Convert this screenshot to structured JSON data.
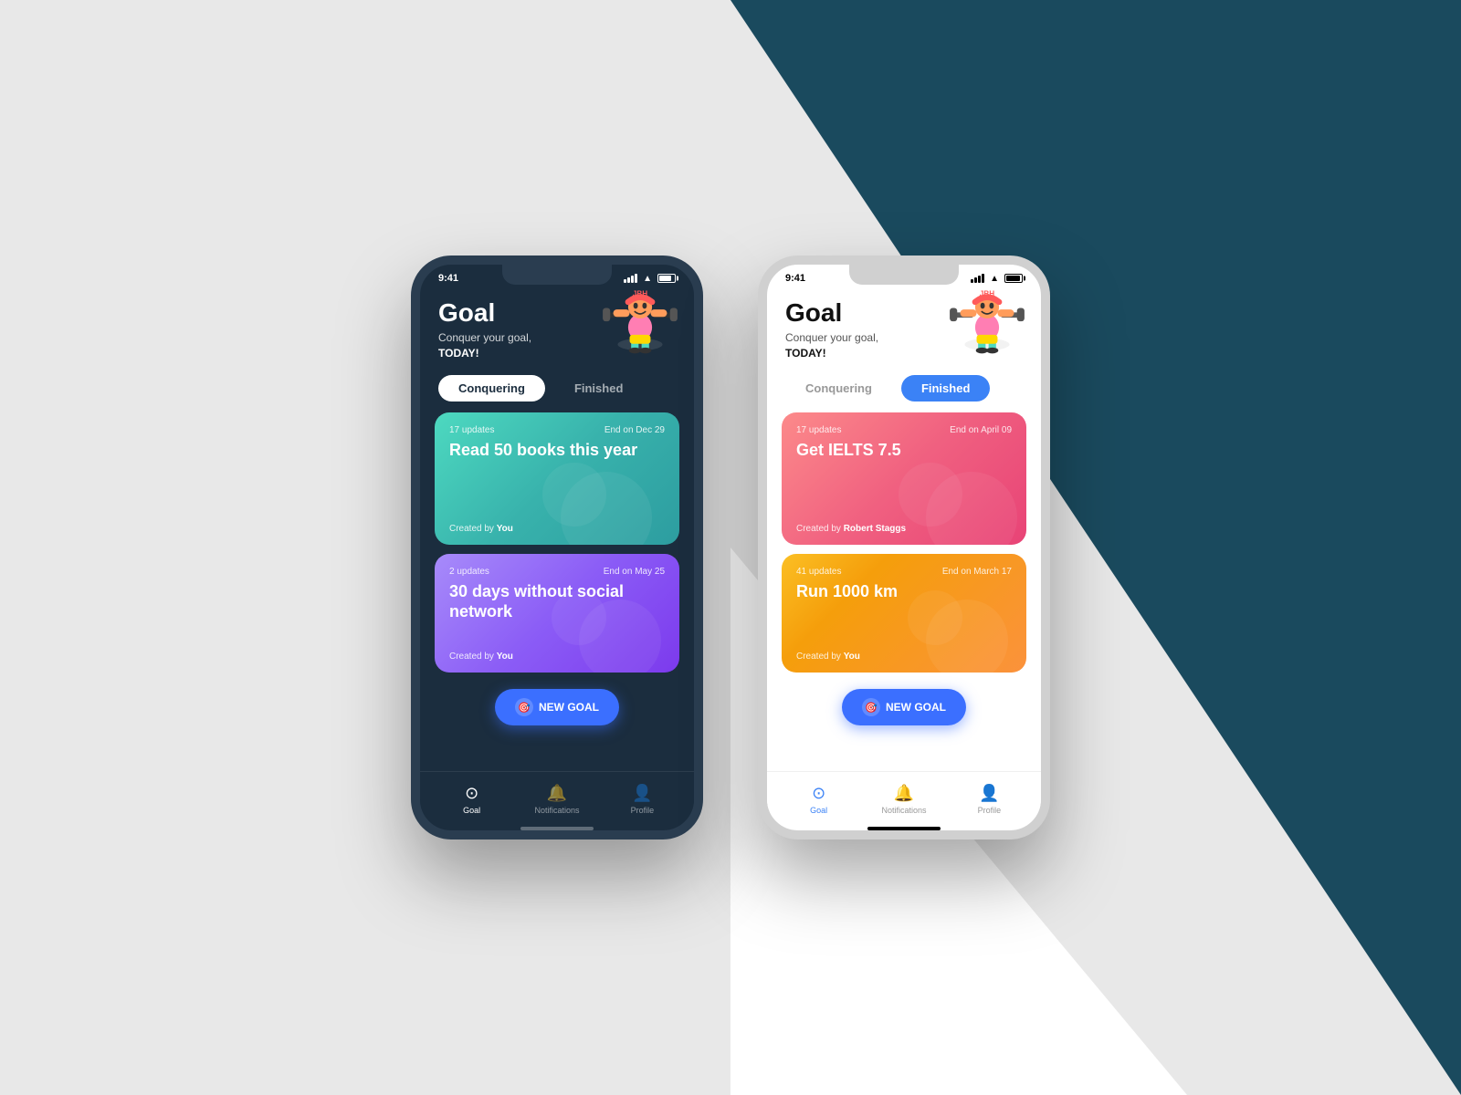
{
  "background": {
    "left_color": "#e8e8e8",
    "right_color": "#1a4a5e"
  },
  "phone_dark": {
    "status_bar": {
      "time": "9:41"
    },
    "header": {
      "title": "Goal",
      "subtitle": "Conquer your goal,",
      "subtitle_bold": "TODAY!"
    },
    "tabs": {
      "conquering": "Conquering",
      "finished": "Finished",
      "active": "conquering"
    },
    "cards": [
      {
        "updates": "17 updates",
        "end_date": "End on Dec 29",
        "title": "Read 50 books this year",
        "creator": "Created by",
        "creator_name": "You",
        "color": "teal"
      },
      {
        "updates": "2 updates",
        "end_date": "End on May 25",
        "title": "30 days without social network",
        "creator": "Created by",
        "creator_name": "You",
        "color": "purple"
      }
    ],
    "new_goal_button": "NEW GOAL",
    "bottom_nav": {
      "items": [
        {
          "label": "Goal",
          "icon": "🎯",
          "active": true
        },
        {
          "label": "Notifications",
          "icon": "🔔",
          "active": false
        },
        {
          "label": "Profile",
          "icon": "👤",
          "active": false
        }
      ]
    }
  },
  "phone_light": {
    "status_bar": {
      "time": "9:41"
    },
    "header": {
      "title": "Goal",
      "subtitle": "Conquer your goal,",
      "subtitle_bold": "TODAY!"
    },
    "tabs": {
      "conquering": "Conquering",
      "finished": "Finished",
      "active": "finished"
    },
    "cards": [
      {
        "updates": "17 updates",
        "end_date": "End on April 09",
        "title": "Get IELTS 7.5",
        "creator": "Created by",
        "creator_name": "Robert Staggs",
        "color": "pink"
      },
      {
        "updates": "41 updates",
        "end_date": "End on March 17",
        "title": "Run 1000 km",
        "creator": "Created by",
        "creator_name": "You",
        "color": "orange"
      }
    ],
    "new_goal_button": "NEW GOAL",
    "bottom_nav": {
      "items": [
        {
          "label": "Goal",
          "icon": "🎯",
          "active": true
        },
        {
          "label": "Notifications",
          "icon": "🔔",
          "active": false
        },
        {
          "label": "Profile",
          "icon": "👤",
          "active": false
        }
      ]
    }
  }
}
